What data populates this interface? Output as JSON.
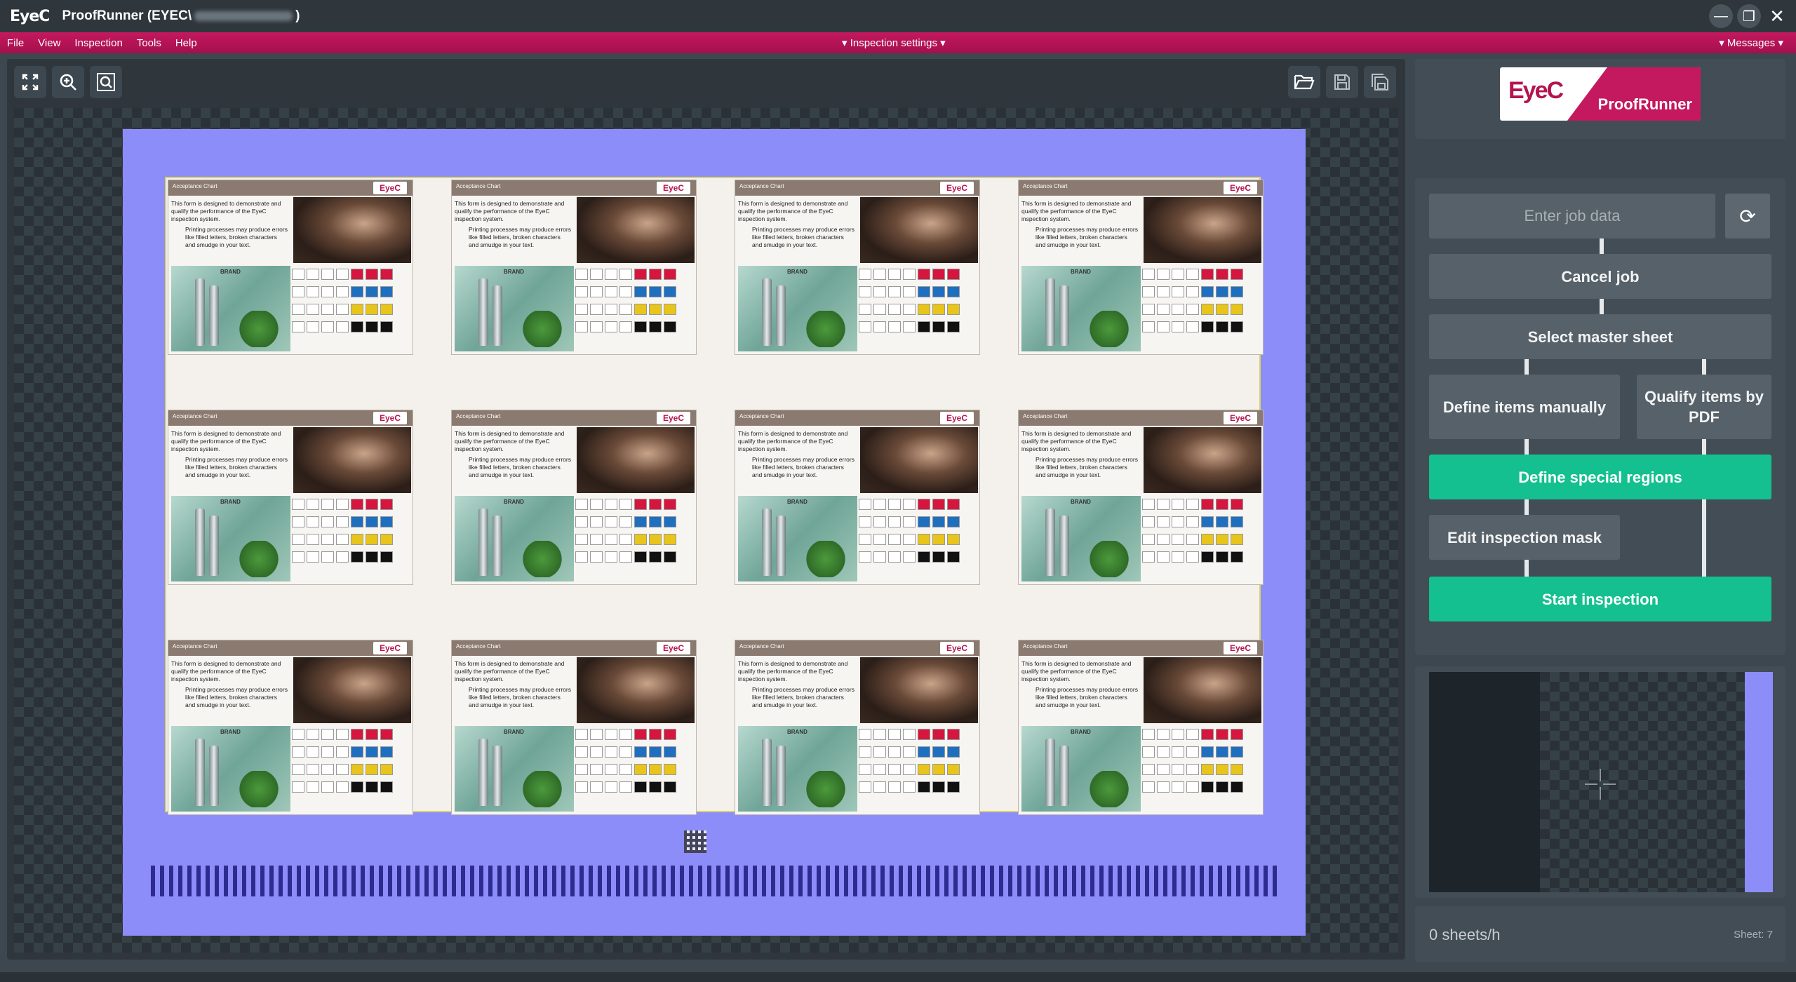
{
  "titlebar": {
    "logo": "EyeC",
    "title_prefix": "ProofRunner  (EYEC\\",
    "title_suffix": ")"
  },
  "window_controls": {
    "minimize": "—",
    "restore": "❐",
    "close": "✕"
  },
  "menu": {
    "items": [
      "File",
      "View",
      "Inspection",
      "Tools",
      "Help"
    ],
    "center": "▾ Inspection settings ▾",
    "right": "▾ Messages ▾"
  },
  "brand": {
    "logo_left": "EyeC",
    "logo_right": "ProofRunner",
    "accent": "#c4185f"
  },
  "chart_text": {
    "header": "Acceptance Chart",
    "logo": "EyeC",
    "body": "This form is designed to demonstrate and qualify the performance of the EyeC inspection system.",
    "body2": "Printing processes may produce errors like filled letters, broken characters and smudge in your text.",
    "brand": "BRAND"
  },
  "workflow": {
    "job_placeholder": "Enter job data",
    "cancel": "Cancel job",
    "select_master": "Select master sheet",
    "define_manual": "Define items manually",
    "qualify_pdf": "Qualify items by PDF",
    "define_special": "Define special regions",
    "edit_mask": "Edit inspection mask",
    "start": "Start inspection",
    "green": "#14c08f"
  },
  "status": {
    "rate": "0 sheets/h",
    "sheet": "Sheet: 7"
  }
}
